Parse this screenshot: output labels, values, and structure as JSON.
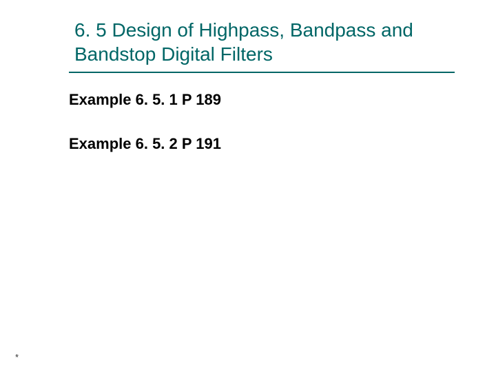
{
  "title": "6. 5 Design of Highpass, Bandpass and Bandstop Digital Filters",
  "examples": {
    "ex1": "Example 6. 5. 1 P 189",
    "ex2": "Example 6. 5. 2 P 191"
  },
  "footer_mark": "*"
}
